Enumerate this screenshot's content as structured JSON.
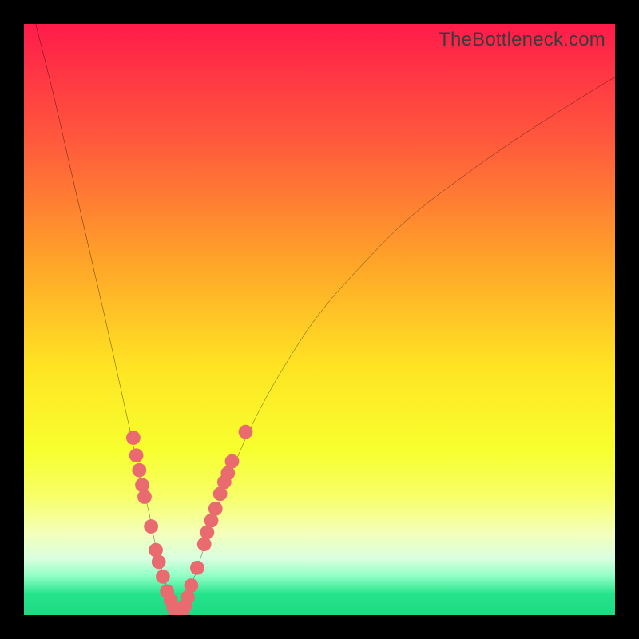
{
  "watermark": "TheBottleneck.com",
  "gradient_stops": [
    {
      "offset": 0.0,
      "color": "#ff1b4a"
    },
    {
      "offset": 0.2,
      "color": "#ff5a3c"
    },
    {
      "offset": 0.4,
      "color": "#ffa329"
    },
    {
      "offset": 0.58,
      "color": "#ffe423"
    },
    {
      "offset": 0.72,
      "color": "#f7ff2e"
    },
    {
      "offset": 0.8,
      "color": "#f7ff68"
    },
    {
      "offset": 0.86,
      "color": "#f4ffb8"
    },
    {
      "offset": 0.905,
      "color": "#d8ffe0"
    },
    {
      "offset": 0.935,
      "color": "#8effc4"
    },
    {
      "offset": 0.965,
      "color": "#24e48a"
    },
    {
      "offset": 1.0,
      "color": "#1fd983"
    }
  ],
  "chart_data": {
    "type": "line",
    "title": "",
    "xlabel": "",
    "ylabel": "",
    "xlim": [
      0,
      100
    ],
    "ylim": [
      0,
      100
    ],
    "series": [
      {
        "name": "left-branch",
        "x": [
          2,
          5,
          8,
          11,
          14,
          16,
          18,
          19.5,
          21,
          22,
          23,
          23.8,
          24.5,
          25.1,
          25.6,
          26
        ],
        "y": [
          100,
          88,
          75,
          62,
          49,
          40,
          31,
          24,
          18,
          13,
          9,
          6,
          3.5,
          1.8,
          0.7,
          0
        ]
      },
      {
        "name": "right-branch",
        "x": [
          26,
          27,
          28.5,
          30,
          32,
          35,
          39,
          44,
          50,
          57,
          65,
          74,
          84,
          95,
          100
        ],
        "y": [
          0,
          2,
          5.5,
          10,
          16,
          24,
          33,
          42,
          51,
          59,
          67,
          74,
          81,
          88,
          91
        ]
      }
    ],
    "dots": {
      "name": "markers",
      "color": "#e96a6f",
      "radius": 1.2,
      "points": [
        {
          "x": 18.5,
          "y": 30
        },
        {
          "x": 19.0,
          "y": 27
        },
        {
          "x": 19.5,
          "y": 24.5
        },
        {
          "x": 20.0,
          "y": 22
        },
        {
          "x": 20.4,
          "y": 20
        },
        {
          "x": 21.5,
          "y": 15
        },
        {
          "x": 22.3,
          "y": 11
        },
        {
          "x": 22.8,
          "y": 9
        },
        {
          "x": 23.5,
          "y": 6.5
        },
        {
          "x": 24.2,
          "y": 4
        },
        {
          "x": 24.8,
          "y": 2.5
        },
        {
          "x": 25.3,
          "y": 1.3
        },
        {
          "x": 25.7,
          "y": 0.5
        },
        {
          "x": 26.0,
          "y": 0.1
        },
        {
          "x": 26.3,
          "y": 0.1
        },
        {
          "x": 26.7,
          "y": 0.4
        },
        {
          "x": 27.2,
          "y": 1.5
        },
        {
          "x": 27.7,
          "y": 3
        },
        {
          "x": 28.3,
          "y": 5
        },
        {
          "x": 29.3,
          "y": 8
        },
        {
          "x": 30.5,
          "y": 12
        },
        {
          "x": 31.0,
          "y": 14
        },
        {
          "x": 31.7,
          "y": 16
        },
        {
          "x": 32.4,
          "y": 18
        },
        {
          "x": 33.2,
          "y": 20.5
        },
        {
          "x": 33.9,
          "y": 22.5
        },
        {
          "x": 34.5,
          "y": 24
        },
        {
          "x": 35.2,
          "y": 26
        },
        {
          "x": 37.5,
          "y": 31
        }
      ]
    }
  }
}
